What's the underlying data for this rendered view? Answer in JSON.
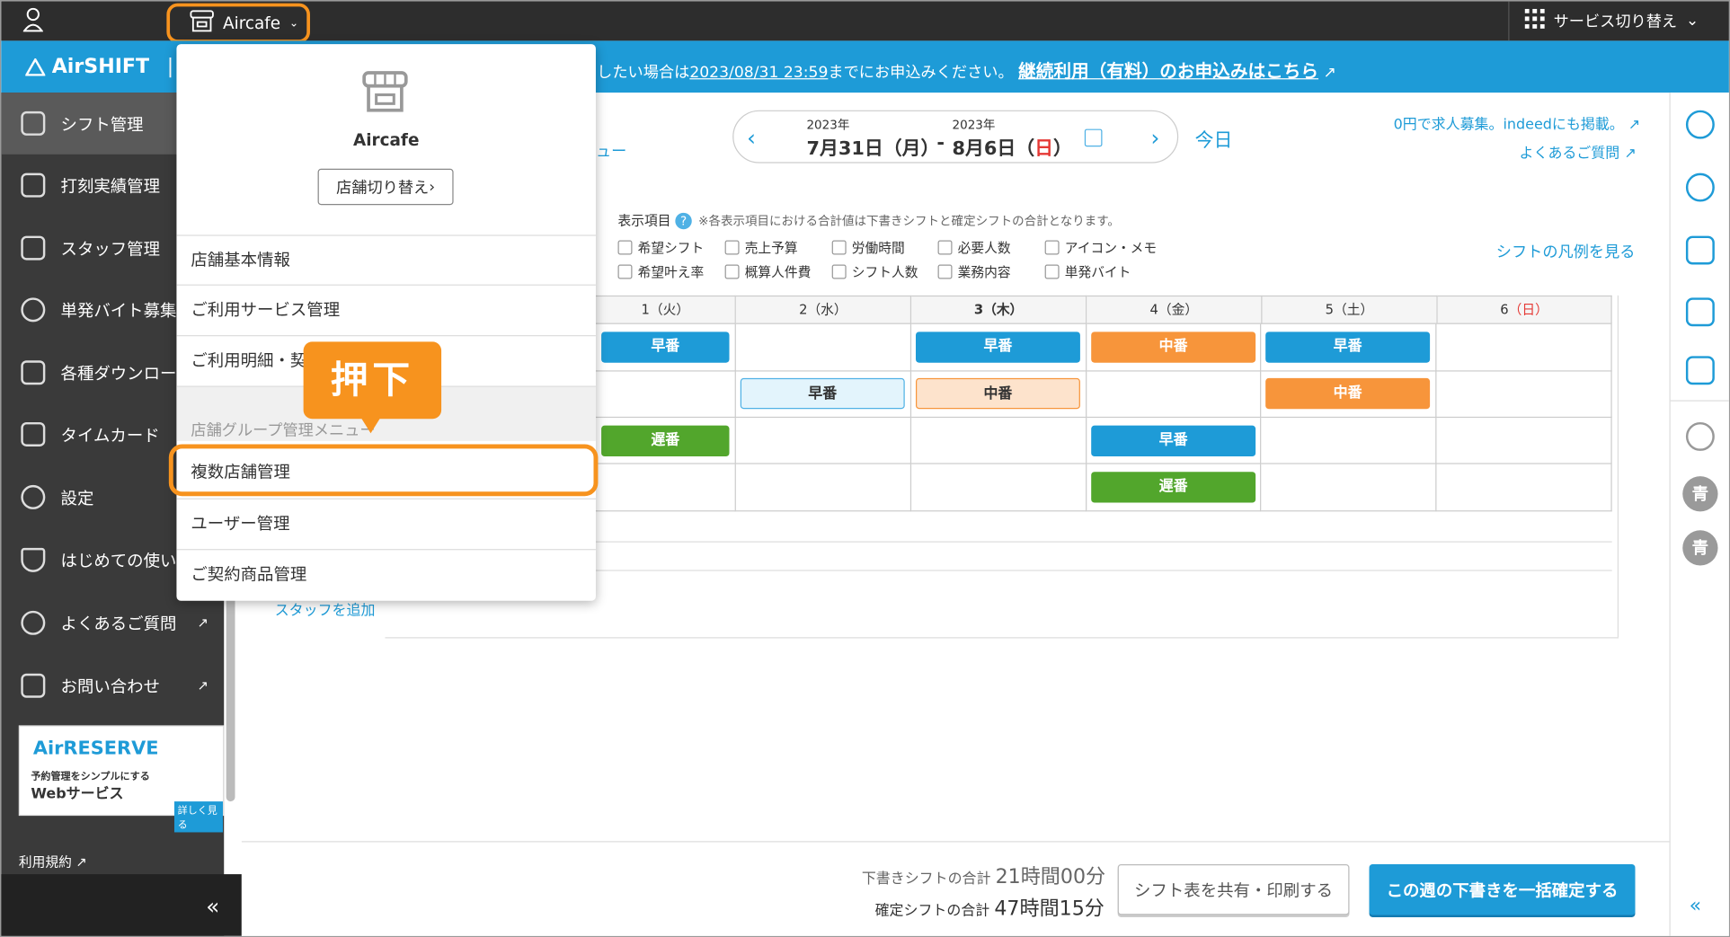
{
  "topbar": {
    "store_name": "Aircafe",
    "service_switch": "サービス切り替え"
  },
  "brand": {
    "logo": "AirSHIFT",
    "notice_pre": "したい場合は",
    "notice_date": "2023/08/31 23:59",
    "notice_mid": "までにお申込みください。",
    "notice_link": "継続利用（有料）のお申込みはこちら"
  },
  "sidebar": {
    "items": [
      {
        "label": "シフト管理",
        "icon": "shift-icon"
      },
      {
        "label": "打刻実績管理",
        "icon": "timestamp-icon"
      },
      {
        "label": "スタッフ管理",
        "icon": "staff-icon"
      },
      {
        "label": "単発バイト募集",
        "icon": "recruit-icon"
      },
      {
        "label": "各種ダウンロード",
        "icon": "download-icon"
      },
      {
        "label": "タイムカード",
        "icon": "timecard-icon"
      },
      {
        "label": "設定",
        "icon": "gear-icon"
      },
      {
        "label": "はじめての使い方",
        "icon": "beginner-icon"
      },
      {
        "label": "よくあるご質問",
        "icon": "question-icon"
      },
      {
        "label": "お問い合わせ",
        "icon": "mail-icon"
      }
    ],
    "ad": {
      "title": "AirRESERVE",
      "sub": "予約管理をシンプルにする",
      "web": "Webサービス",
      "more": "詳しく見る"
    },
    "terms": "利用規約"
  },
  "dates": {
    "year1": "2023年",
    "date1": "7月31日（月）",
    "sep": "-",
    "year2": "2023年",
    "date2_pre": "8月6日（",
    "date2_day": "日",
    "date2_post": "）",
    "today": "今日"
  },
  "links": {
    "recruit": "0円で求人募集。indeedにも掲載。",
    "faq": "よくあるご質問",
    "legend": "シフトの凡例を見る",
    "add_staff": "スタッフを追加",
    "menu_partial": "ュー"
  },
  "display": {
    "title": "表示項目",
    "note": "※各表示項目における合計値は下書きシフトと確定シフトの合計となります。",
    "options": [
      "希望シフト",
      "売上予算",
      "労働時間",
      "必要人数",
      "アイコン・メモ",
      "希望叶え率",
      "概算人件費",
      "シフト人数",
      "業務内容",
      "単発バイト"
    ]
  },
  "grid": {
    "headers": [
      {
        "n": "1",
        "d": "（火）"
      },
      {
        "n": "2",
        "d": "（水）"
      },
      {
        "n": "3",
        "d": "（木）"
      },
      {
        "n": "4",
        "d": "（金）"
      },
      {
        "n": "5",
        "d": "（土）"
      },
      {
        "n": "6",
        "d": "（日）"
      }
    ],
    "chips": [
      "早番",
      "早番",
      "中番",
      "早番",
      "早番",
      "中番",
      "中番",
      "遅番",
      "早番",
      "遅番"
    ]
  },
  "dropdown": {
    "store_name": "Aircafe",
    "switch": "店舗切り替え",
    "items": [
      "店舗基本情報",
      "ご利用サービス管理",
      "ご利用明細・契"
    ],
    "group_title": "店舗グループ管理メニュー",
    "group_items": [
      "複数店舗管理",
      "ユーザー管理",
      "ご契約商品管理"
    ]
  },
  "callout": "押下",
  "rail": {
    "avatars": [
      "青",
      "青"
    ]
  },
  "bottom": {
    "draft_label": "下書きシフトの合計",
    "draft_value": "21時間00分",
    "confirmed_label": "確定シフトの合計",
    "confirmed_value": "47時間15分",
    "share": "シフト表を共有・印刷する",
    "confirm": "この週の下書きを一括確定する"
  },
  "colors": {
    "accent": "#1e9bd7",
    "highlight": "#f7931e",
    "early": "#1e9bd7",
    "middle": "#f7953b",
    "late": "#52a62c"
  }
}
